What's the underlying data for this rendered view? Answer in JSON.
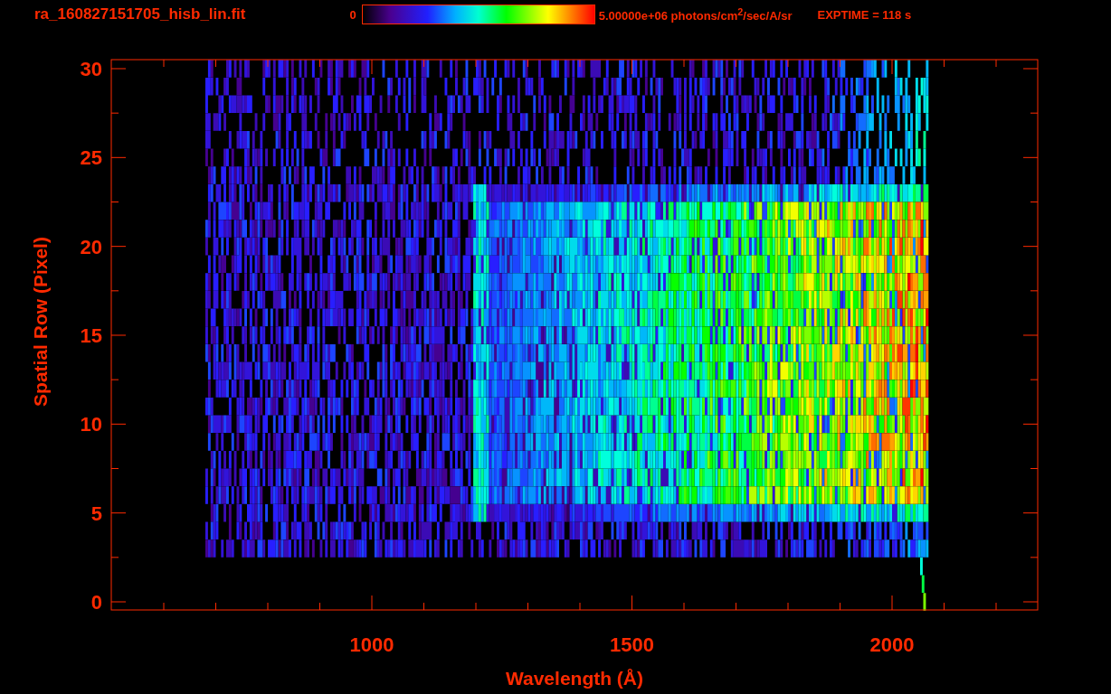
{
  "title": "ra_160827151705_hisb_lin.fit",
  "colorbar": {
    "min_label": "0",
    "max_label": "5.00000e+06 photons/cm$^{2}$/sec/A/sr"
  },
  "exposure": "EXPTIME = 118 s",
  "plot": {
    "xlabel": "Wavelength (Å)",
    "ylabel": "Spatial Row (Pixel)",
    "xticks": [
      "1000",
      "1500",
      "2000"
    ],
    "yticks": [
      "30",
      "25",
      "20",
      "15",
      "10",
      "5",
      "0"
    ]
  }
}
